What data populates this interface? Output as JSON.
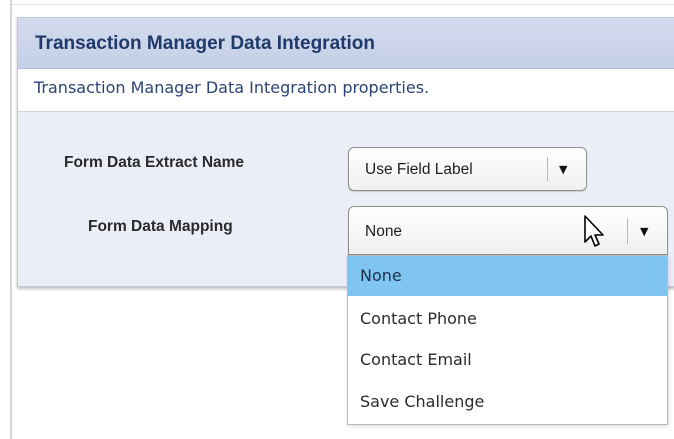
{
  "panel": {
    "title": "Transaction Manager Data Integration",
    "description": "Transaction Manager Data Integration properties."
  },
  "fields": {
    "extract_name": {
      "label": "Form Data Extract Name",
      "value": "Use Field Label"
    },
    "mapping": {
      "label": "Form Data Mapping",
      "value": "None"
    }
  },
  "dropdown": {
    "selected_index": 0,
    "options": [
      "None",
      "Contact Phone",
      "Contact Email",
      "Save Challenge"
    ]
  },
  "icons": {
    "arrow": "▼",
    "cursor": "mouse-pointer-icon"
  },
  "colors": {
    "header_text": "#1f3a6a",
    "description_text": "#2c4475",
    "highlight": "#80c5f2"
  }
}
